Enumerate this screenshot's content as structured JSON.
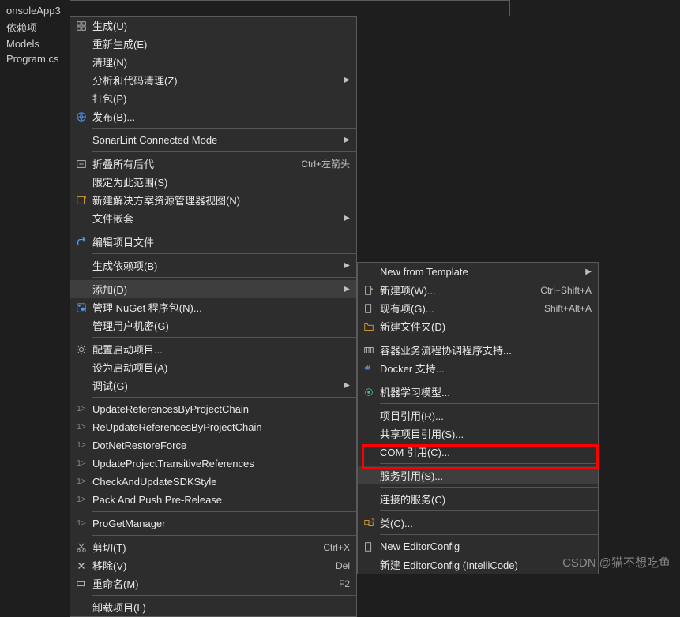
{
  "tree": {
    "project": "onsoleApp3",
    "items": [
      "依赖项",
      "Models",
      "Program.cs"
    ]
  },
  "menu_main": [
    {
      "type": "item",
      "icon": "build-icon",
      "label": "生成(U)"
    },
    {
      "type": "item",
      "icon": "",
      "label": "重新生成(E)"
    },
    {
      "type": "item",
      "icon": "",
      "label": "清理(N)"
    },
    {
      "type": "item",
      "icon": "",
      "label": "分析和代码清理(Z)",
      "arrow": true
    },
    {
      "type": "item",
      "icon": "",
      "label": "打包(P)"
    },
    {
      "type": "item",
      "icon": "publish-icon",
      "label": "发布(B)..."
    },
    {
      "type": "sep"
    },
    {
      "type": "item",
      "icon": "",
      "label": "SonarLint Connected Mode",
      "arrow": true
    },
    {
      "type": "sep"
    },
    {
      "type": "item",
      "icon": "collapse-icon",
      "label": "折叠所有后代",
      "shortcut": "Ctrl+左箭头"
    },
    {
      "type": "item",
      "icon": "",
      "label": "限定为此范围(S)"
    },
    {
      "type": "item",
      "icon": "new-view-icon",
      "label": "新建解决方案资源管理器视图(N)"
    },
    {
      "type": "item",
      "icon": "",
      "label": "文件嵌套",
      "arrow": true
    },
    {
      "type": "sep"
    },
    {
      "type": "item",
      "icon": "edit-icon",
      "label": "编辑项目文件"
    },
    {
      "type": "sep"
    },
    {
      "type": "item",
      "icon": "",
      "label": "生成依赖项(B)",
      "arrow": true
    },
    {
      "type": "sep"
    },
    {
      "type": "item",
      "icon": "",
      "label": "添加(D)",
      "arrow": true,
      "hover": true
    },
    {
      "type": "item",
      "icon": "nuget-icon",
      "label": "管理 NuGet 程序包(N)..."
    },
    {
      "type": "item",
      "icon": "",
      "label": "管理用户机密(G)"
    },
    {
      "type": "sep"
    },
    {
      "type": "item",
      "icon": "gear-icon",
      "label": "配置启动项目..."
    },
    {
      "type": "item",
      "icon": "",
      "label": "设为启动项目(A)"
    },
    {
      "type": "item",
      "icon": "",
      "label": "调试(G)",
      "arrow": true
    },
    {
      "type": "sep"
    },
    {
      "type": "item",
      "icon": "ps-icon",
      "label": "UpdateReferencesByProjectChain"
    },
    {
      "type": "item",
      "icon": "ps-icon",
      "label": "ReUpdateReferencesByProjectChain"
    },
    {
      "type": "item",
      "icon": "ps-icon",
      "label": "DotNetRestoreForce"
    },
    {
      "type": "item",
      "icon": "ps-icon",
      "label": "UpdateProjectTransitiveReferences"
    },
    {
      "type": "item",
      "icon": "ps-icon",
      "label": "CheckAndUpdateSDKStyle"
    },
    {
      "type": "item",
      "icon": "ps-icon",
      "label": "Pack And Push Pre-Release"
    },
    {
      "type": "sep"
    },
    {
      "type": "item",
      "icon": "ps-icon",
      "label": "ProGetManager"
    },
    {
      "type": "sep"
    },
    {
      "type": "item",
      "icon": "cut-icon",
      "label": "剪切(T)",
      "shortcut": "Ctrl+X"
    },
    {
      "type": "item",
      "icon": "delete-icon",
      "label": "移除(V)",
      "shortcut": "Del"
    },
    {
      "type": "item",
      "icon": "rename-icon",
      "label": "重命名(M)",
      "shortcut": "F2"
    },
    {
      "type": "sep"
    },
    {
      "type": "item",
      "icon": "",
      "label": "卸载项目(L)"
    }
  ],
  "menu_sub": [
    {
      "type": "item",
      "icon": "",
      "label": "New from Template",
      "arrow": true
    },
    {
      "type": "item",
      "icon": "new-item-icon",
      "label": "新建项(W)...",
      "shortcut": "Ctrl+Shift+A"
    },
    {
      "type": "item",
      "icon": "existing-item-icon",
      "label": "现有项(G)...",
      "shortcut": "Shift+Alt+A"
    },
    {
      "type": "item",
      "icon": "folder-icon",
      "label": "新建文件夹(D)"
    },
    {
      "type": "sep"
    },
    {
      "type": "item",
      "icon": "container-icon",
      "label": "容器业务流程协调程序支持..."
    },
    {
      "type": "item",
      "icon": "docker-icon",
      "label": "Docker 支持..."
    },
    {
      "type": "sep"
    },
    {
      "type": "item",
      "icon": "ml-icon",
      "label": "机器学习模型..."
    },
    {
      "type": "sep"
    },
    {
      "type": "item",
      "icon": "",
      "label": "项目引用(R)..."
    },
    {
      "type": "item",
      "icon": "",
      "label": "共享项目引用(S)..."
    },
    {
      "type": "item",
      "icon": "",
      "label": "COM 引用(C)..."
    },
    {
      "type": "sep"
    },
    {
      "type": "item",
      "icon": "",
      "label": "服务引用(S)...",
      "hover": true
    },
    {
      "type": "sep"
    },
    {
      "type": "item",
      "icon": "",
      "label": "连接的服务(C)"
    },
    {
      "type": "sep"
    },
    {
      "type": "item",
      "icon": "class-icon",
      "label": "类(C)..."
    },
    {
      "type": "sep"
    },
    {
      "type": "item",
      "icon": "file-icon",
      "label": "New EditorConfig"
    },
    {
      "type": "item",
      "icon": "",
      "label": "新建 EditorConfig (IntelliCode)"
    }
  ],
  "watermark": "CSDN @猫不想吃鱼"
}
